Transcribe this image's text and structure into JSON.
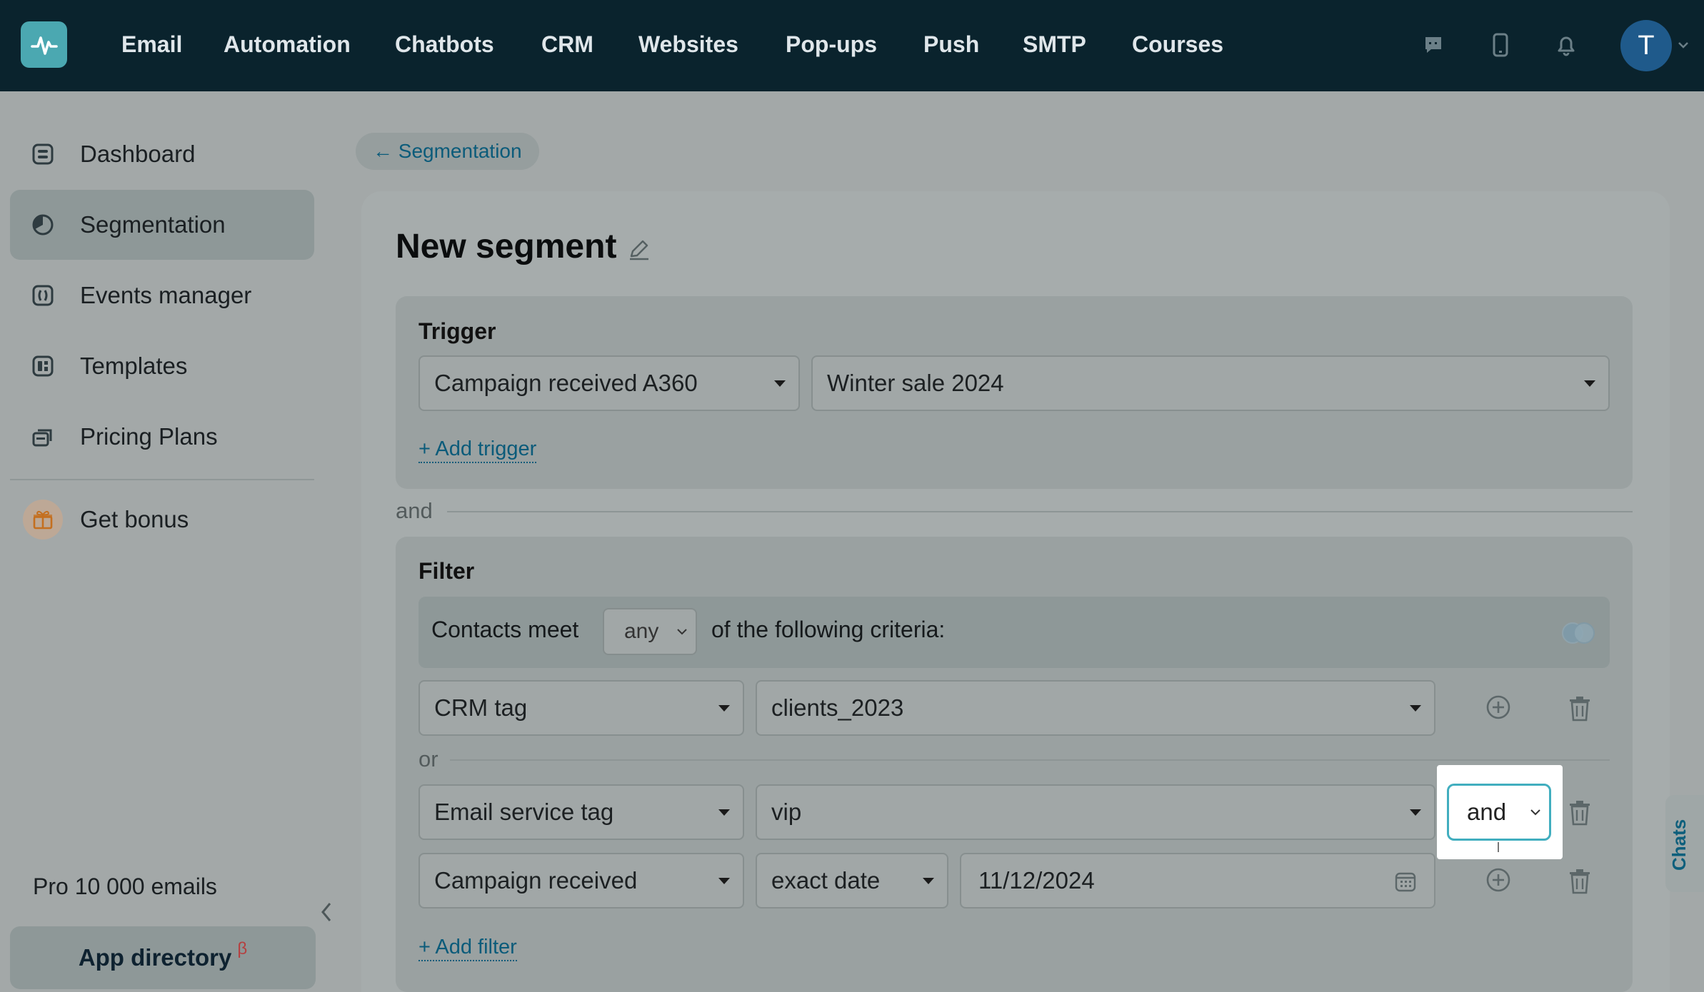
{
  "topnav": {
    "items": [
      "Email",
      "Automation",
      "Chatbots",
      "CRM",
      "Websites",
      "Pop-ups",
      "Push",
      "SMTP",
      "Courses"
    ],
    "icons": [
      "chat-icon",
      "mobile-icon",
      "bell-icon"
    ],
    "avatar_letter": "T"
  },
  "sidebar": {
    "items": [
      {
        "label": "Dashboard",
        "icon": "dashboard-icon"
      },
      {
        "label": "Segmentation",
        "icon": "segmentation-icon",
        "active": true
      },
      {
        "label": "Events manager",
        "icon": "events-icon"
      },
      {
        "label": "Templates",
        "icon": "templates-icon"
      },
      {
        "label": "Pricing Plans",
        "icon": "pricing-icon"
      }
    ],
    "bonus": "Get bonus",
    "plan": "Pro 10 000 emails",
    "app_directory": "App directory",
    "app_directory_badge": "β"
  },
  "breadcrumb": "← Segmentation",
  "title": "New segment",
  "trigger": {
    "heading": "Trigger",
    "event": "Campaign received A360",
    "campaign": "Winter sale 2024",
    "add_label": "+ Add trigger"
  },
  "separator_and": "and",
  "filter": {
    "heading": "Filter",
    "criteria_prefix": "Contacts meet",
    "criteria_mode": "any",
    "criteria_suffix": "of the following criteria:",
    "rows": [
      {
        "field": "CRM tag",
        "value": "clients_2023"
      },
      {
        "field": "Email service tag",
        "value": "vip",
        "logic": "and"
      },
      {
        "field": "Campaign received",
        "condition": "exact date",
        "date": "11/12/2024"
      }
    ],
    "or_label": "or",
    "add_label": "+ Add filter"
  },
  "chats_tab": "Chats",
  "colors": {
    "topbar": "#0a232d",
    "accent": "#41aebf",
    "link": "#0b5b7a"
  }
}
